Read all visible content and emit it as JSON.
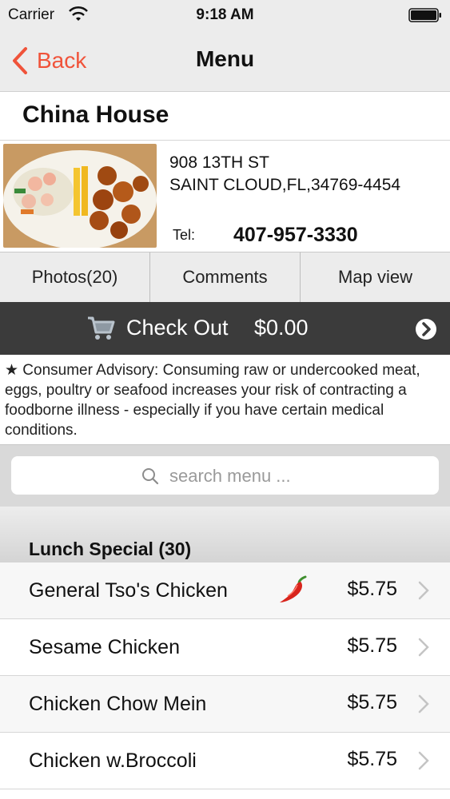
{
  "status_bar": {
    "carrier": "Carrier",
    "time": "9:18 AM"
  },
  "nav": {
    "back_label": "Back",
    "title": "Menu"
  },
  "restaurant": {
    "name": "China House",
    "address_line1": "908 13TH ST",
    "address_line2": "SAINT CLOUD,FL,34769-4454",
    "tel_label": "Tel:",
    "tel": "407-957-3330"
  },
  "tabs": [
    {
      "label": "Photos(20)"
    },
    {
      "label": "Comments"
    },
    {
      "label": "Map view"
    }
  ],
  "checkout": {
    "label": "Check Out",
    "amount": "$0.00"
  },
  "advisory": "★ Consumer Advisory: Consuming raw or undercooked meat, eggs, poultry or seafood increases your risk of contracting a foodborne illness - especially if you have certain medical conditions.",
  "search": {
    "placeholder": "search menu ..."
  },
  "section": {
    "title": "Lunch Special (30)"
  },
  "items": [
    {
      "name": "General Tso's Chicken",
      "price": "$5.75",
      "spicy": true
    },
    {
      "name": "Sesame Chicken",
      "price": "$5.75",
      "spicy": false
    },
    {
      "name": "Chicken Chow Mein",
      "price": "$5.75",
      "spicy": false
    },
    {
      "name": "Chicken w.Broccoli",
      "price": "$5.75",
      "spicy": false
    }
  ],
  "colors": {
    "accent": "#f0533a",
    "checkout_bg": "#3b3b3b"
  },
  "icons": {
    "wifi": "wifi-icon",
    "battery": "battery-icon",
    "back": "chevron-left-icon",
    "cart": "cart-icon",
    "arrow": "arrow-circle-icon",
    "search": "search-icon",
    "pepper": "chili-pepper-icon",
    "chevron": "chevron-right-icon"
  }
}
